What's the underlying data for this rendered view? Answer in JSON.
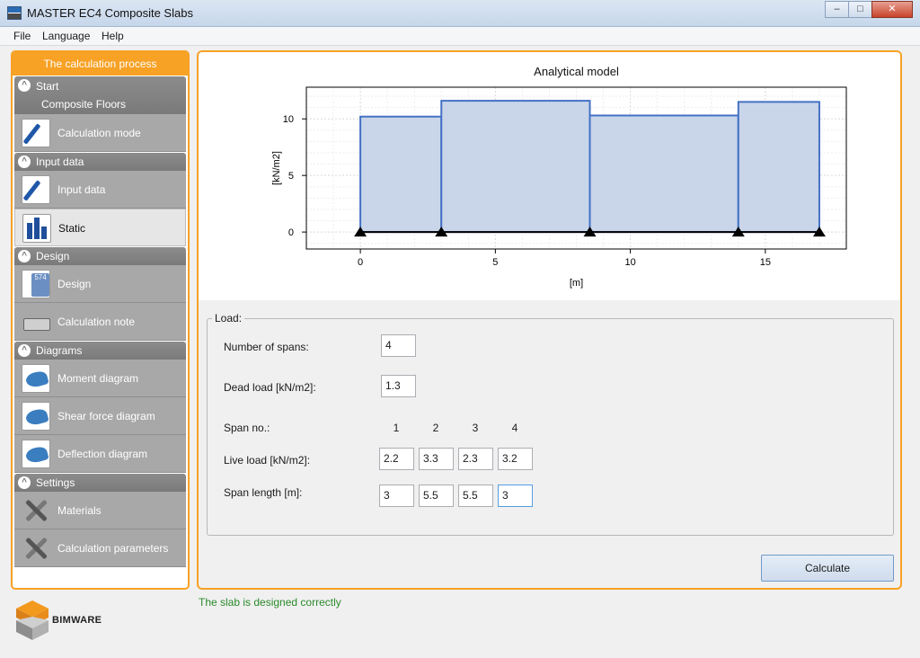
{
  "window": {
    "title": "MASTER EC4 Composite Slabs",
    "min": "–",
    "max": "□",
    "close": "✕"
  },
  "menu": [
    "File",
    "Language",
    "Help"
  ],
  "sidebar": {
    "header": "The calculation process",
    "sections": [
      {
        "title": "Start",
        "subtitle": "Composite Floors",
        "items": [
          {
            "label": "Calculation mode",
            "icon": "pen-icon"
          }
        ]
      },
      {
        "title": "Input data",
        "items": [
          {
            "label": "Input data",
            "icon": "pen-icon"
          },
          {
            "label": "Static",
            "icon": "bar-chart-icon",
            "active": true
          }
        ]
      },
      {
        "title": "Design",
        "items": [
          {
            "label": "Design",
            "icon": "calculator-icon"
          },
          {
            "label": "Calculation note",
            "icon": "printer-icon"
          }
        ]
      },
      {
        "title": "Diagrams",
        "items": [
          {
            "label": "Moment diagram",
            "icon": "diagram-icon"
          },
          {
            "label": "Shear force diagram",
            "icon": "diagram-icon"
          },
          {
            "label": "Deflection diagram",
            "icon": "diagram-icon"
          }
        ]
      },
      {
        "title": "Settings",
        "items": [
          {
            "label": "Materials",
            "icon": "tools-icon"
          },
          {
            "label": "Calculation parameters",
            "icon": "tools-icon"
          }
        ]
      }
    ]
  },
  "chart_data": {
    "type": "area",
    "title": "Analytical model",
    "xlabel": "[m]",
    "ylabel": "[kN/m2]",
    "xlim": [
      -2,
      18
    ],
    "ylim": [
      -1.5,
      12.8
    ],
    "xticks": [
      0,
      5,
      10,
      15
    ],
    "yticks": [
      0,
      5,
      10
    ],
    "grid": true,
    "segments": [
      {
        "x0": 0,
        "x1": 3,
        "value": 10.2
      },
      {
        "x0": 3,
        "x1": 8.5,
        "value": 11.6
      },
      {
        "x0": 8.5,
        "x1": 14,
        "value": 10.3
      },
      {
        "x0": 14,
        "x1": 17,
        "value": 11.5
      }
    ],
    "supports": [
      0,
      3,
      8.5,
      14,
      17
    ],
    "fill_color": "#c9d6ea",
    "line_color": "#4472c4"
  },
  "load": {
    "legend": "Load:",
    "num_spans_label": "Number of spans:",
    "num_spans": "4",
    "dead_load_label": "Dead load [kN/m2]:",
    "dead_load": "1.3",
    "span_no_label": "Span no.:",
    "span_numbers": [
      "1",
      "2",
      "3",
      "4"
    ],
    "live_load_label": "Live load [kN/m2]:",
    "live_loads": [
      "2.2",
      "3.3",
      "2.3",
      "3.2"
    ],
    "span_length_label": "Span length [m]:",
    "span_lengths": [
      "3",
      "5.5",
      "5.5",
      "3"
    ]
  },
  "calculate_label": "Calculate",
  "status": "The slab is designed correctly",
  "status_color": "#2a8a2a",
  "accent_color": "#f7a125",
  "logo_text": "BIMWARE"
}
